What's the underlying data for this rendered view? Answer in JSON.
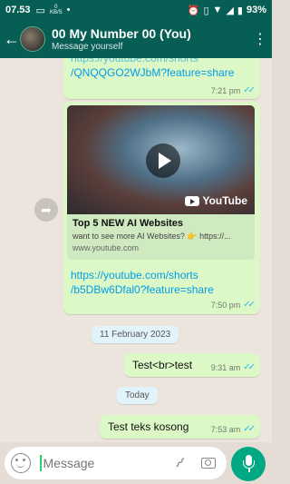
{
  "status_bar": {
    "time": "07.53",
    "data_speed_value": "0",
    "data_speed_unit": "KB/S",
    "battery": "93%",
    "icons": [
      "message-icon",
      "alarm-icon",
      "vibrate-icon",
      "wifi-icon",
      "signal-icon",
      "battery-icon"
    ]
  },
  "header": {
    "title": "00 My Number 00 (You)",
    "subtitle": "Message yourself",
    "back_icon": "arrow-left-icon",
    "menu_icon": "more-vert-icon"
  },
  "messages": [
    {
      "id": "m1",
      "link_lines": [
        "https://youtube.com/shorts",
        "/QNQQGO2WJbM?feature=share"
      ],
      "time": "7:21 pm",
      "status": "read"
    },
    {
      "id": "m2",
      "preview": {
        "title": "Top 5 NEW AI Websites",
        "description": "want to see more AI Websites? 👉 https://...",
        "domain": "www.youtube.com",
        "brand": "YouTube"
      },
      "link_lines": [
        "https://youtube.com/shorts",
        "/b5DBw6Dfal0?feature=share"
      ],
      "time": "7:50 pm",
      "status": "read"
    },
    {
      "id": "m3",
      "text": "Test<br>test",
      "time": "9:31 am",
      "status": "read"
    },
    {
      "id": "m4",
      "text": "Test teks kosong",
      "time": "7:53 am",
      "status": "read"
    }
  ],
  "date_separators": [
    "11 February 2023",
    "Today"
  ],
  "composer": {
    "placeholder": "Message",
    "icons": [
      "emoji-icon",
      "attach-icon",
      "camera-icon",
      "mic-icon"
    ]
  },
  "colors": {
    "header": "#075e54",
    "outgoing_bubble": "#dcf8c6",
    "link": "#039be5",
    "read_ticks": "#34b7f1",
    "mic_button": "#00a884"
  }
}
